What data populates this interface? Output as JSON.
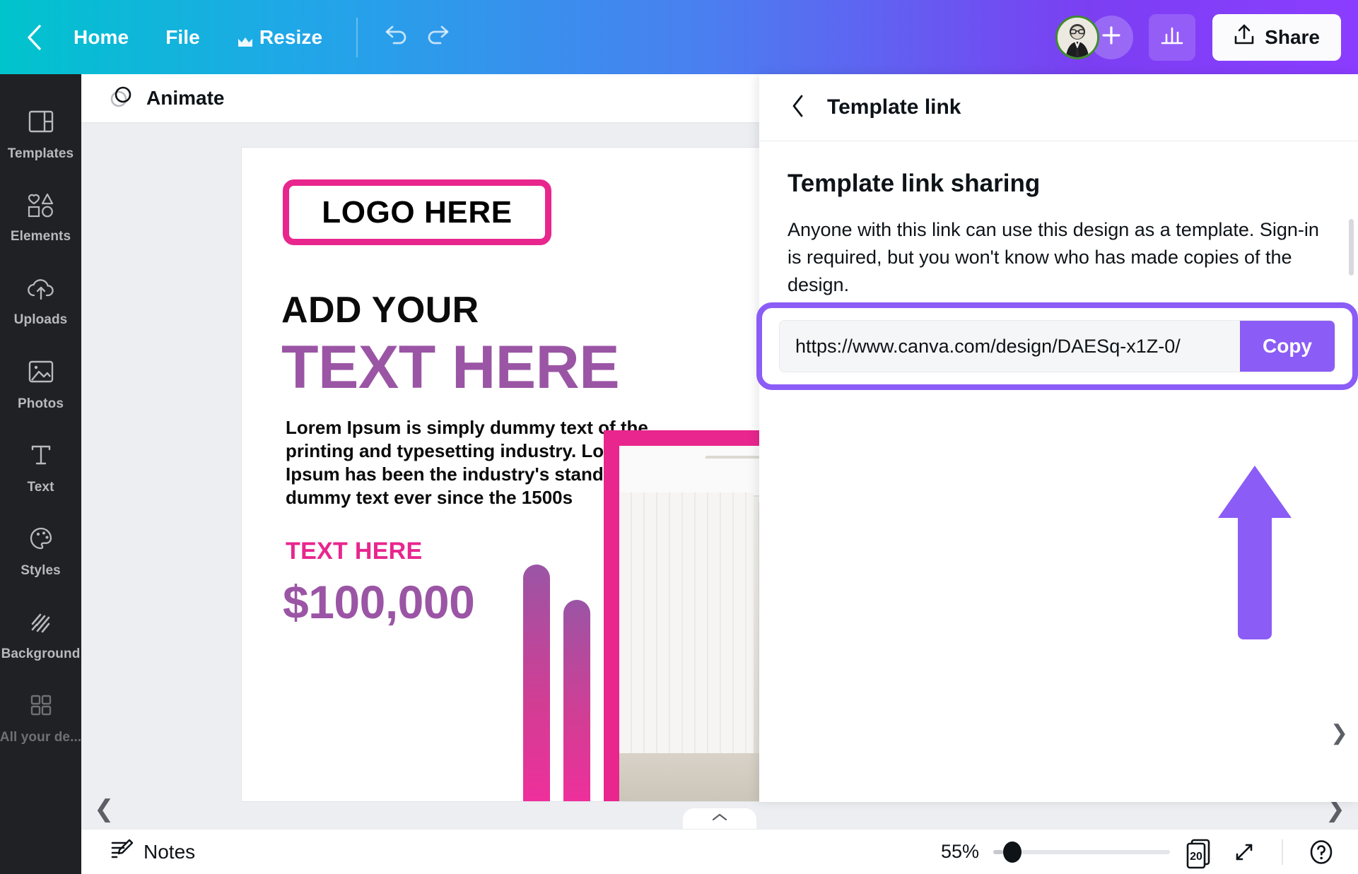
{
  "header": {
    "back_icon": "chevron-left-icon",
    "home_label": "Home",
    "file_label": "File",
    "resize_label": "Resize",
    "resize_icon": "crown-icon",
    "undo_icon": "undo-icon",
    "redo_icon": "redo-icon",
    "avatar_icon": "user-avatar",
    "add_member_icon": "plus-icon",
    "insights_icon": "bar-chart-icon",
    "share_label": "Share",
    "share_icon": "upload-icon",
    "gradient_start": "#00c4cc",
    "gradient_end": "#8b3dff"
  },
  "sidebar": {
    "items": [
      {
        "label": "Templates",
        "icon": "templates-icon"
      },
      {
        "label": "Elements",
        "icon": "elements-icon"
      },
      {
        "label": "Uploads",
        "icon": "cloud-upload-icon"
      },
      {
        "label": "Photos",
        "icon": "image-icon"
      },
      {
        "label": "Text",
        "icon": "text-t-icon"
      },
      {
        "label": "Styles",
        "icon": "palette-icon"
      },
      {
        "label": "Background",
        "icon": "hatch-pattern-icon"
      },
      {
        "label": "All your de...",
        "icon": "grid-squares-icon"
      }
    ]
  },
  "toolbar": {
    "animate_label": "Animate",
    "animate_icon": "animate-circles-icon"
  },
  "canvas": {
    "logo_text": "LOGO HERE",
    "heading_line1": "ADD YOUR",
    "heading_line2": "TEXT HERE",
    "body_text": "Lorem Ipsum is simply dummy text of the printing and typesetting industry. Lorem Ipsum has been the industry's standard dummy text ever since the 1500s",
    "subheading": "TEXT HERE",
    "price": "$100,000",
    "accent_pink": "#e8268e",
    "accent_purple": "#9b55a5",
    "nav_left_icon": "chevron-left-icon",
    "nav_right_icon": "chevron-right-icon",
    "handle_icon": "chevron-up-icon"
  },
  "panel": {
    "back_icon": "chevron-left-icon",
    "title": "Template link",
    "heading": "Template link sharing",
    "description": "Anyone with this link can use this design as a template. Sign-in is required, but you won't know who has made copies of the design.",
    "link_url": "https://www.canva.com/design/DAESq-x1Z-0/",
    "copy_label": "Copy",
    "highlight_color": "#8b5cf6",
    "collapse_icon": "chevron-down-icon"
  },
  "bottombar": {
    "notes_label": "Notes",
    "notes_icon": "notes-pencil-icon",
    "zoom_level": "55%",
    "pages_count": "20",
    "pages_icon": "pages-icon",
    "expand_icon": "expand-arrows-icon",
    "help_label": "?",
    "help_icon": "help-circle-icon"
  }
}
